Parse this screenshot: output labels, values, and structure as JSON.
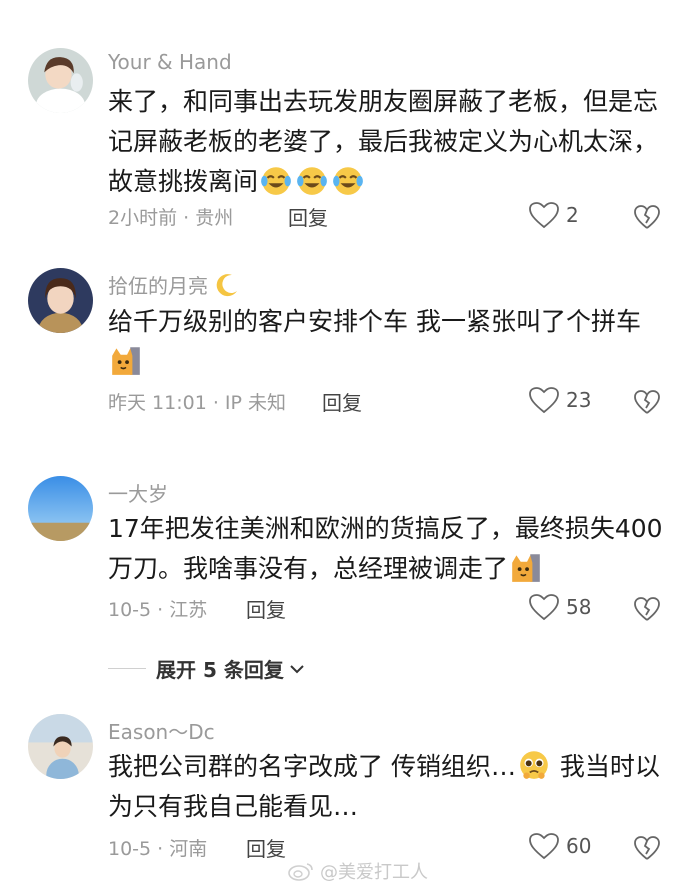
{
  "comments": [
    {
      "username": "Your  &  Hand",
      "text": "来了，和同事出去玩发朋友圈屏蔽了老板，但是忘记屏蔽老板的老婆了，最后我被定义为心机太深，故意挑拨离间",
      "emojis": [
        "tears-of-joy",
        "tears-of-joy",
        "tears-of-joy"
      ],
      "meta": "2小时前 · 贵州",
      "reply_label": "回复",
      "likes": "2"
    },
    {
      "username": "拾伍的月亮",
      "name_icon": "crescent-moon",
      "text": "给千万级别的客户安排个车 我一紧张叫了个拼车",
      "emojis": [
        "peeking-cat"
      ],
      "meta": "昨天 11:01 · IP 未知",
      "reply_label": "回复",
      "likes": "23"
    },
    {
      "username": "一大岁",
      "text": "17年把发往美洲和欧洲的货搞反了，最终损失400万刀。我啥事没有，总经理被调走了",
      "emojis": [
        "peeking-cat"
      ],
      "meta": "10-5 · 江苏",
      "reply_label": "回复",
      "likes": "58"
    },
    {
      "username": "Eason～Dc",
      "text": "我把公司群的名字改成了 传销组织…",
      "text_after": " 我当时以为只有我自己能看见…",
      "emojis": [
        "pleading-face"
      ],
      "meta": "10-5 · 河南",
      "reply_label": "回复",
      "likes": "60"
    }
  ],
  "expand_replies": "展开 5 条回复",
  "watermark": "@美爱打工人",
  "colors": {
    "secondary_text": "#9a9a9a",
    "primary_text": "#1a1a1a"
  }
}
